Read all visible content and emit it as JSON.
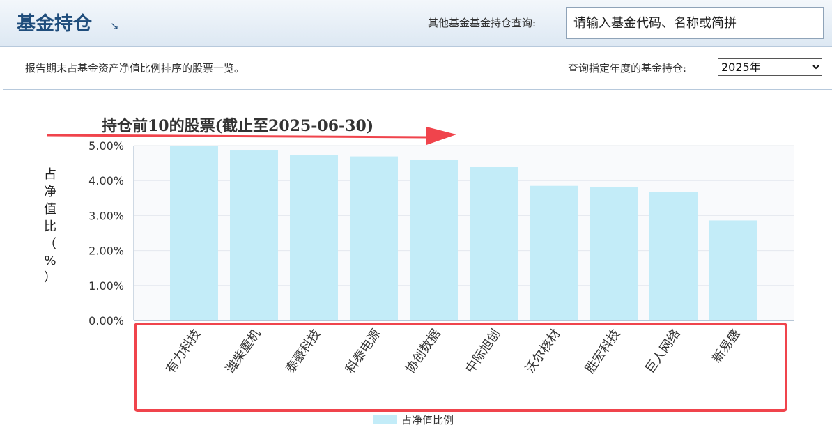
{
  "header": {
    "title": "基金持仓",
    "title_icon": "↘",
    "search_label": "其他基金基金持仓查询:",
    "search_placeholder": "请输入基金代码、名称或简拼"
  },
  "subbar": {
    "description": "报告期末占基金资产净值比例排序的股票一览。",
    "year_label": "查询指定年度的基金持仓:",
    "year_selected": "2025年"
  },
  "colors": {
    "bar_fill": "#c3ecf8",
    "annotation_red": "#f0444c",
    "grid": "#e4e8ee",
    "plot_bg": "#f9fafc",
    "axis": "#9fb3c8"
  },
  "chart_data": {
    "type": "bar",
    "title": "持仓前10的股票(截止至2025-06-30)",
    "ylabel": "占净值比（%）",
    "categories": [
      "有力科技",
      "潍柴重机",
      "泰豪科技",
      "科泰电源",
      "协创数据",
      "中际旭创",
      "沃尔核材",
      "胜宏科技",
      "巨人网络",
      "新易盛"
    ],
    "series": [
      {
        "name": "占净值比例",
        "values": [
          4.99,
          4.86,
          4.74,
          4.69,
          4.59,
          4.39,
          3.85,
          3.82,
          3.67,
          2.86
        ]
      }
    ],
    "ylim": [
      0,
      5
    ],
    "yticks": [
      "0.00%",
      "1.00%",
      "2.00%",
      "3.00%",
      "4.00%",
      "5.00%"
    ],
    "grid": true,
    "legend": "bottom"
  }
}
